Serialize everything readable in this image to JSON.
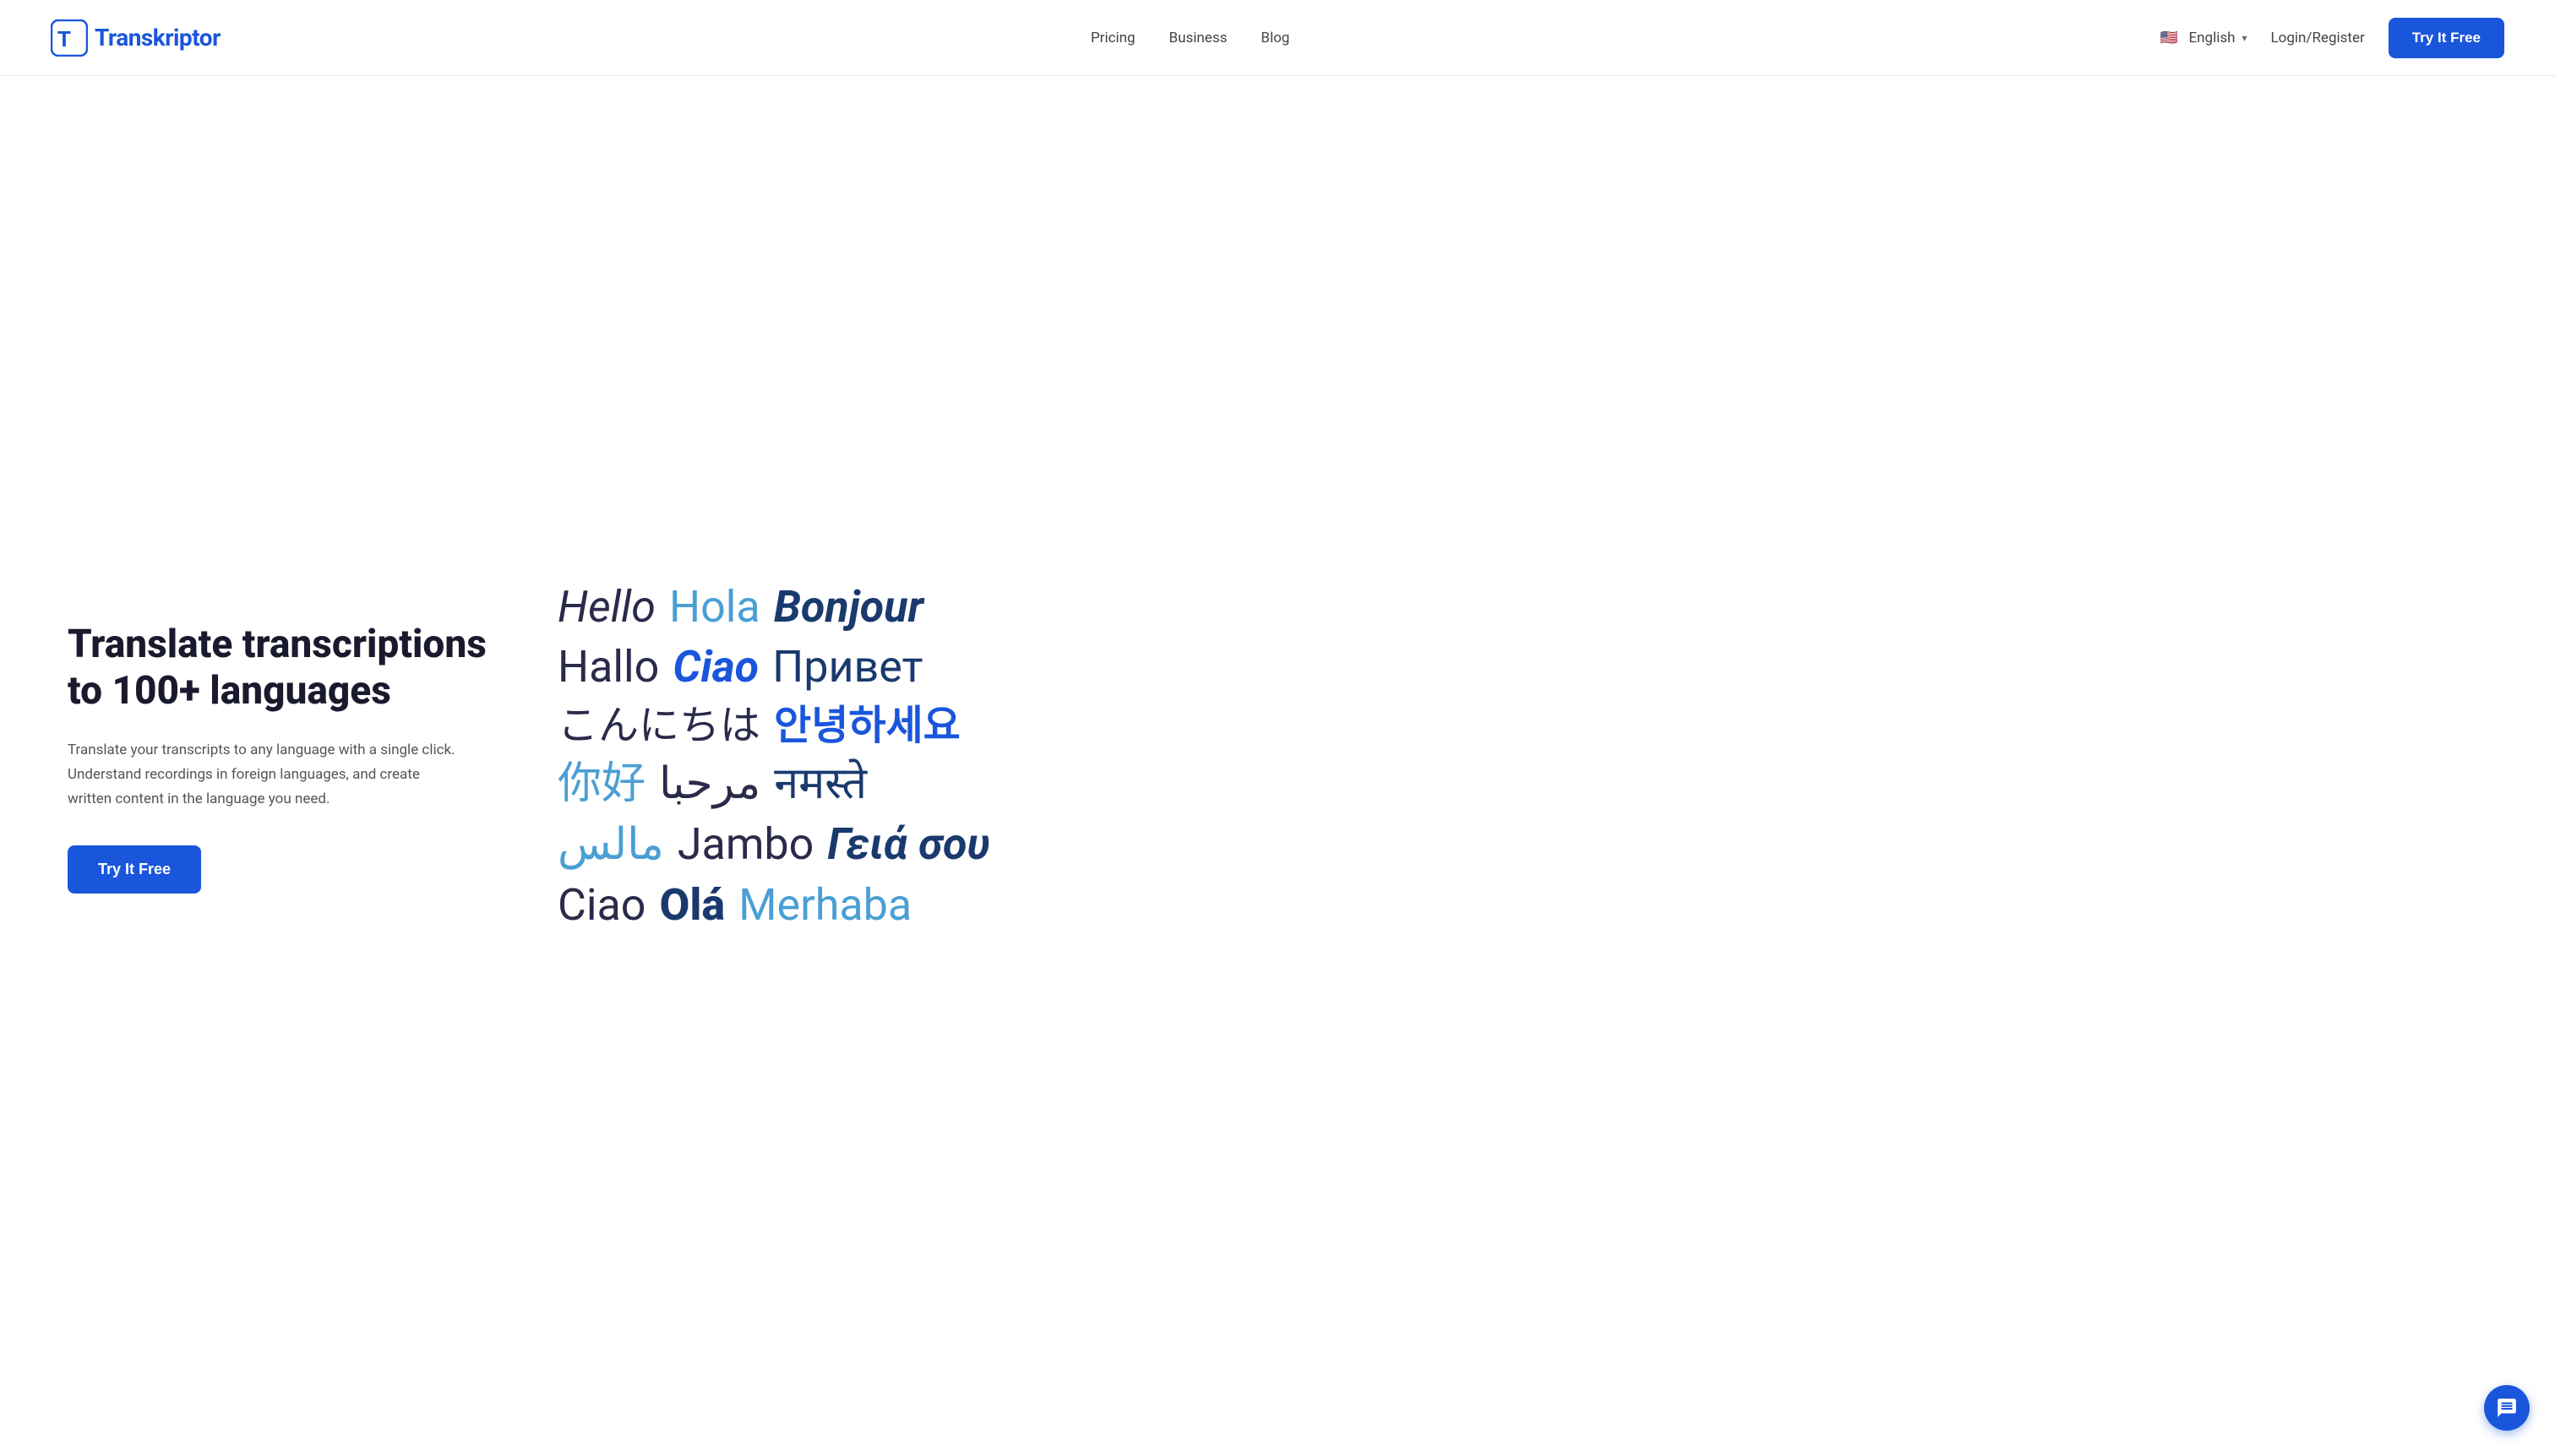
{
  "brand": {
    "name": "Transkriptor",
    "logo_letter": "T"
  },
  "navbar": {
    "links": [
      {
        "label": "Pricing",
        "id": "pricing"
      },
      {
        "label": "Business",
        "id": "business"
      },
      {
        "label": "Blog",
        "id": "blog"
      }
    ],
    "language": {
      "selected": "English",
      "flag_emoji": "🇺🇸"
    },
    "login_label": "Login/Register",
    "cta_label": "Try It Free"
  },
  "hero": {
    "title": "Translate transcriptions to 100+ languages",
    "description": "Translate your transcripts to any language with a single click. Understand recordings in foreign languages, and create written content in the language you need.",
    "cta_label": "Try It Free"
  },
  "multilingual": {
    "row1": [
      {
        "word": "Hello",
        "style": "hello"
      },
      {
        "word": "Hola",
        "style": "hola"
      },
      {
        "word": "Bonjour",
        "style": "bonjour"
      }
    ],
    "row2": [
      {
        "word": "Hallo",
        "style": "hallo"
      },
      {
        "word": "Ciao",
        "style": "ciao"
      },
      {
        "word": "Привет",
        "style": "privet"
      }
    ],
    "row3": [
      {
        "word": "こんにちは",
        "style": "konnichiwa"
      },
      {
        "word": "안녕하세요",
        "style": "annyeong"
      }
    ],
    "row4": [
      {
        "word": "你好",
        "style": "nihao"
      },
      {
        "word": "مرحبا",
        "style": "marhaba"
      },
      {
        "word": "नमस्ते",
        "style": "namaste"
      }
    ],
    "row5": [
      {
        "word": "مالس",
        "style": "salam"
      },
      {
        "word": "Jambo",
        "style": "jambo"
      },
      {
        "word": "Γειά σου",
        "style": "yiasou"
      }
    ],
    "row6": [
      {
        "word": "Ciao",
        "style": "ciao2"
      },
      {
        "word": "Olá",
        "style": "ola"
      },
      {
        "word": "Merhaba",
        "style": "merhaba"
      }
    ]
  },
  "chat": {
    "label": "Chat support"
  },
  "colors": {
    "accent": "#1a56db",
    "text_dark": "#1a1a2e",
    "text_mid": "#555555",
    "text_light": "#4a9fd4"
  }
}
